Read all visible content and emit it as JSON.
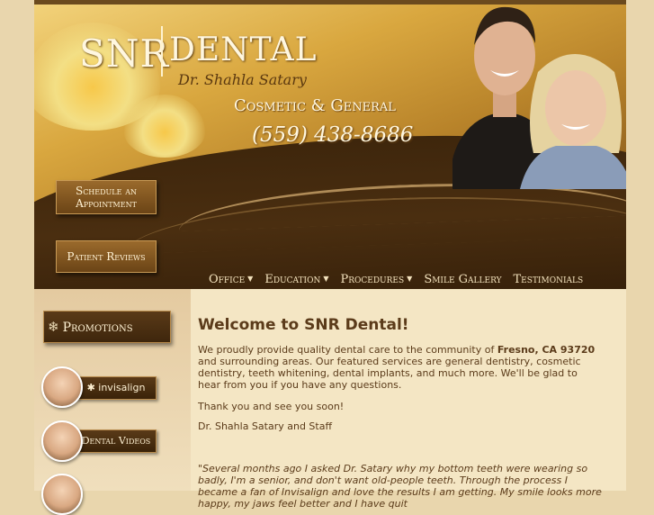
{
  "header": {
    "logo_left": "SNR",
    "logo_right": "DENTAL",
    "doctor": "Dr. Shahla Satary",
    "tagline": "Cosmetic & General",
    "phone": "(559) 438-8686"
  },
  "side_buttons": {
    "schedule_line1": "Schedule an",
    "schedule_line2": "Appointment",
    "reviews": "Patient Reviews"
  },
  "nav": [
    {
      "label": "Office",
      "dropdown": true
    },
    {
      "label": "Education",
      "dropdown": true
    },
    {
      "label": "Procedures",
      "dropdown": true
    },
    {
      "label": "Smile Gallery",
      "dropdown": false
    },
    {
      "label": "Testimonials",
      "dropdown": false
    }
  ],
  "left": {
    "promotions": "Promotions",
    "invisalign": "invisalign",
    "videos": "Dental Videos"
  },
  "main": {
    "title": "Welcome to SNR Dental!",
    "intro_a": "We proudly provide quality dental care to the community of ",
    "intro_city": "Fresno, CA 93720",
    "intro_b": " and surrounding areas. Our featured services are general dentistry, cosmetic dentistry, teeth whitening, dental implants, and much more. We'll be glad to hear from you if you have any questions.",
    "thanks": "Thank you and see you soon!",
    "signoff": "Dr. Shahla Satary and Staff",
    "quote": "\"Several months ago I asked Dr. Satary why my bottom teeth were wearing so badly, I'm a senior, and don't want old-people teeth. Through the process I became a fan of Invisalign and love the results I am getting. My smile looks more happy, my jaws feel better and I have quit"
  },
  "colors": {
    "accent_dark": "#3e260c",
    "gold": "#d9a73f",
    "text_brown": "#5b3b1a",
    "cream": "#f4e6c4"
  }
}
